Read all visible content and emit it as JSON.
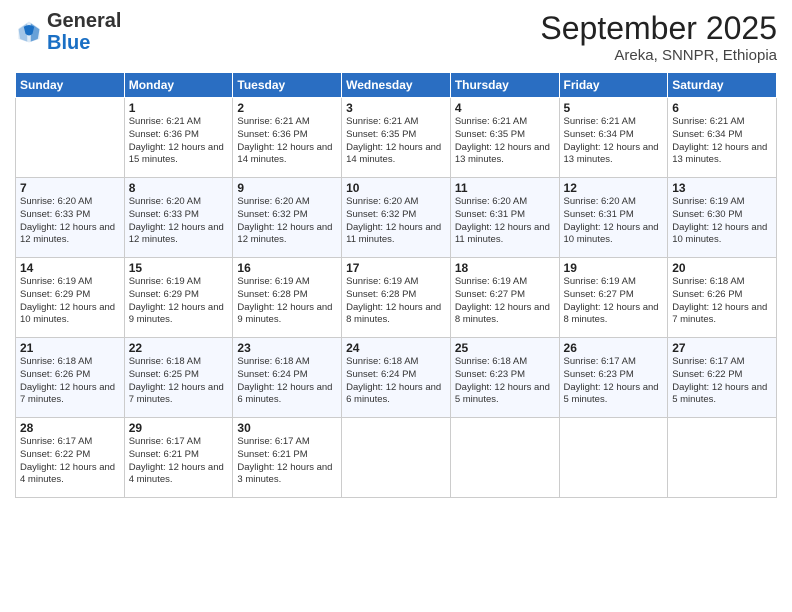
{
  "logo": {
    "general": "General",
    "blue": "Blue"
  },
  "header": {
    "month": "September 2025",
    "location": "Areka, SNNPR, Ethiopia"
  },
  "days_of_week": [
    "Sunday",
    "Monday",
    "Tuesday",
    "Wednesday",
    "Thursday",
    "Friday",
    "Saturday"
  ],
  "weeks": [
    [
      {
        "day": "",
        "sunrise": "",
        "sunset": "",
        "daylight": ""
      },
      {
        "day": "1",
        "sunrise": "6:21 AM",
        "sunset": "6:36 PM",
        "daylight": "12 hours and 15 minutes."
      },
      {
        "day": "2",
        "sunrise": "6:21 AM",
        "sunset": "6:36 PM",
        "daylight": "12 hours and 14 minutes."
      },
      {
        "day": "3",
        "sunrise": "6:21 AM",
        "sunset": "6:35 PM",
        "daylight": "12 hours and 14 minutes."
      },
      {
        "day": "4",
        "sunrise": "6:21 AM",
        "sunset": "6:35 PM",
        "daylight": "12 hours and 13 minutes."
      },
      {
        "day": "5",
        "sunrise": "6:21 AM",
        "sunset": "6:34 PM",
        "daylight": "12 hours and 13 minutes."
      },
      {
        "day": "6",
        "sunrise": "6:21 AM",
        "sunset": "6:34 PM",
        "daylight": "12 hours and 13 minutes."
      }
    ],
    [
      {
        "day": "7",
        "sunrise": "6:20 AM",
        "sunset": "6:33 PM",
        "daylight": "12 hours and 12 minutes."
      },
      {
        "day": "8",
        "sunrise": "6:20 AM",
        "sunset": "6:33 PM",
        "daylight": "12 hours and 12 minutes."
      },
      {
        "day": "9",
        "sunrise": "6:20 AM",
        "sunset": "6:32 PM",
        "daylight": "12 hours and 12 minutes."
      },
      {
        "day": "10",
        "sunrise": "6:20 AM",
        "sunset": "6:32 PM",
        "daylight": "12 hours and 11 minutes."
      },
      {
        "day": "11",
        "sunrise": "6:20 AM",
        "sunset": "6:31 PM",
        "daylight": "12 hours and 11 minutes."
      },
      {
        "day": "12",
        "sunrise": "6:20 AM",
        "sunset": "6:31 PM",
        "daylight": "12 hours and 10 minutes."
      },
      {
        "day": "13",
        "sunrise": "6:19 AM",
        "sunset": "6:30 PM",
        "daylight": "12 hours and 10 minutes."
      }
    ],
    [
      {
        "day": "14",
        "sunrise": "6:19 AM",
        "sunset": "6:29 PM",
        "daylight": "12 hours and 10 minutes."
      },
      {
        "day": "15",
        "sunrise": "6:19 AM",
        "sunset": "6:29 PM",
        "daylight": "12 hours and 9 minutes."
      },
      {
        "day": "16",
        "sunrise": "6:19 AM",
        "sunset": "6:28 PM",
        "daylight": "12 hours and 9 minutes."
      },
      {
        "day": "17",
        "sunrise": "6:19 AM",
        "sunset": "6:28 PM",
        "daylight": "12 hours and 8 minutes."
      },
      {
        "day": "18",
        "sunrise": "6:19 AM",
        "sunset": "6:27 PM",
        "daylight": "12 hours and 8 minutes."
      },
      {
        "day": "19",
        "sunrise": "6:19 AM",
        "sunset": "6:27 PM",
        "daylight": "12 hours and 8 minutes."
      },
      {
        "day": "20",
        "sunrise": "6:18 AM",
        "sunset": "6:26 PM",
        "daylight": "12 hours and 7 minutes."
      }
    ],
    [
      {
        "day": "21",
        "sunrise": "6:18 AM",
        "sunset": "6:26 PM",
        "daylight": "12 hours and 7 minutes."
      },
      {
        "day": "22",
        "sunrise": "6:18 AM",
        "sunset": "6:25 PM",
        "daylight": "12 hours and 7 minutes."
      },
      {
        "day": "23",
        "sunrise": "6:18 AM",
        "sunset": "6:24 PM",
        "daylight": "12 hours and 6 minutes."
      },
      {
        "day": "24",
        "sunrise": "6:18 AM",
        "sunset": "6:24 PM",
        "daylight": "12 hours and 6 minutes."
      },
      {
        "day": "25",
        "sunrise": "6:18 AM",
        "sunset": "6:23 PM",
        "daylight": "12 hours and 5 minutes."
      },
      {
        "day": "26",
        "sunrise": "6:17 AM",
        "sunset": "6:23 PM",
        "daylight": "12 hours and 5 minutes."
      },
      {
        "day": "27",
        "sunrise": "6:17 AM",
        "sunset": "6:22 PM",
        "daylight": "12 hours and 5 minutes."
      }
    ],
    [
      {
        "day": "28",
        "sunrise": "6:17 AM",
        "sunset": "6:22 PM",
        "daylight": "12 hours and 4 minutes."
      },
      {
        "day": "29",
        "sunrise": "6:17 AM",
        "sunset": "6:21 PM",
        "daylight": "12 hours and 4 minutes."
      },
      {
        "day": "30",
        "sunrise": "6:17 AM",
        "sunset": "6:21 PM",
        "daylight": "12 hours and 3 minutes."
      },
      {
        "day": "",
        "sunrise": "",
        "sunset": "",
        "daylight": ""
      },
      {
        "day": "",
        "sunrise": "",
        "sunset": "",
        "daylight": ""
      },
      {
        "day": "",
        "sunrise": "",
        "sunset": "",
        "daylight": ""
      },
      {
        "day": "",
        "sunrise": "",
        "sunset": "",
        "daylight": ""
      }
    ]
  ]
}
